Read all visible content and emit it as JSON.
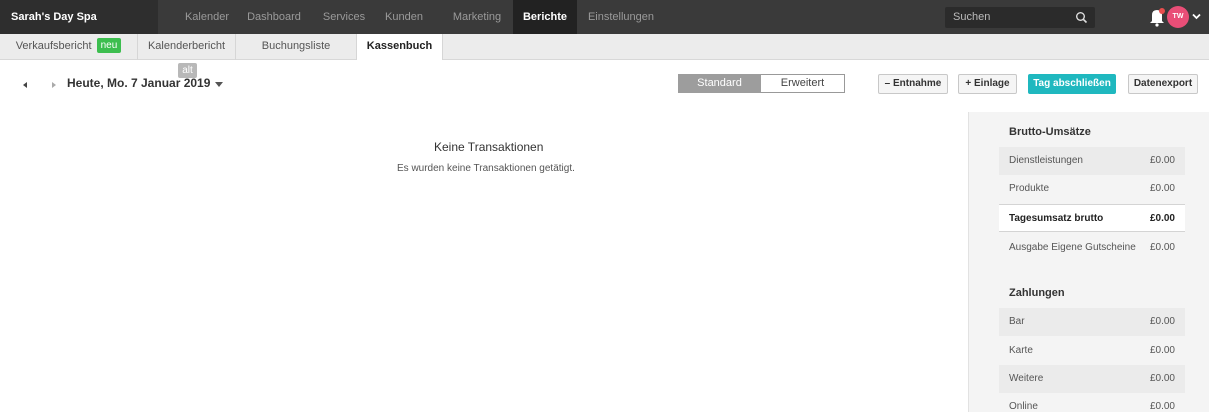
{
  "brand": "Sarah's Day Spa",
  "nav": {
    "items": [
      {
        "label": "Kalender",
        "active": false
      },
      {
        "label": "Dashboard",
        "active": false
      },
      {
        "label": "Services",
        "active": false
      },
      {
        "label": "Kunden",
        "active": false
      },
      {
        "label": "Marketing",
        "active": false
      },
      {
        "label": "Berichte",
        "active": true
      },
      {
        "label": "Einstellungen",
        "active": false
      }
    ],
    "search_placeholder": "Suchen",
    "avatar_initials": "TW"
  },
  "subtabs": [
    {
      "label": "Verkaufsbericht",
      "badge": "neu"
    },
    {
      "label": "Kalenderbericht",
      "badge": "alt"
    },
    {
      "label": "Buchungsliste"
    },
    {
      "label": "Kassenbuch",
      "active": true
    }
  ],
  "toolbar": {
    "date": "Heute, Mo. 7 Januar 2019",
    "view_standard": "Standard",
    "view_extended": "Erweitert",
    "withdraw_label": "Entnahme",
    "deposit_label": "Einlage",
    "close_day_label": "Tag abschließen",
    "export_label": "Datenexport"
  },
  "empty": {
    "title": "Keine Transaktionen",
    "subtitle": "Es wurden keine Transaktionen getätigt."
  },
  "summary": {
    "gross_heading": "Brutto-Umsätze",
    "gross_rows": [
      {
        "label": "Dienstleistungen",
        "value": "£0.00"
      },
      {
        "label": "Produkte",
        "value": "£0.00"
      },
      {
        "label": "Tagesumsatz brutto",
        "value": "£0.00"
      },
      {
        "label": "Ausgabe Eigene Gutscheine",
        "value": "£0.00"
      }
    ],
    "payments_heading": "Zahlungen",
    "payment_rows": [
      {
        "label": "Bar",
        "value": "£0.00"
      },
      {
        "label": "Karte",
        "value": "£0.00"
      },
      {
        "label": "Weitere",
        "value": "£0.00"
      },
      {
        "label": "Online",
        "value": "£0.00"
      }
    ]
  },
  "colors": {
    "accent": "#1fb8bf",
    "topbar": "#3a3a3a",
    "badge_new": "#3dbe4f",
    "avatar": "#e94e77"
  }
}
